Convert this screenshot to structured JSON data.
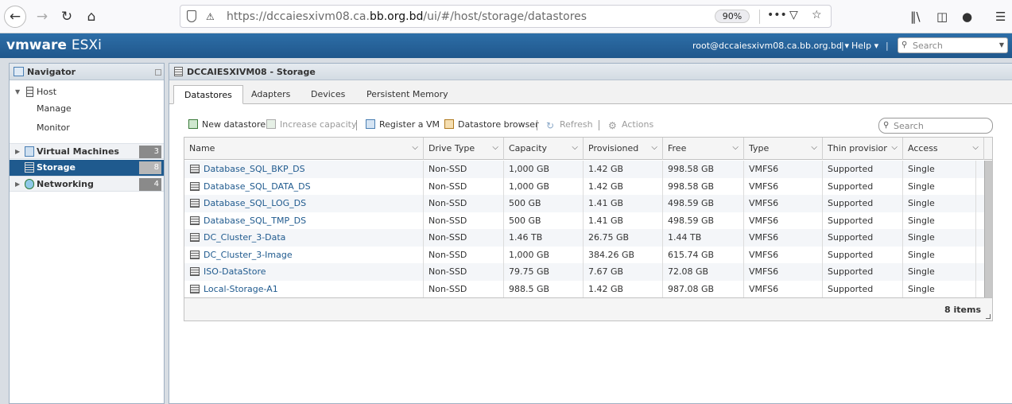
{
  "browser": {
    "url_prefix": "https://dccaiesxivm08.ca.",
    "url_domain": "bb.org.bd",
    "url_suffix": "/ui/#/host/storage/datastores",
    "zoom": "90%"
  },
  "header": {
    "logo_vm": "vmware",
    "logo_product": "ESXi",
    "user": "root@dccaiesxivm08.ca.bb.org.bd ▾",
    "help": "Help ▾",
    "search_placeholder": "Search"
  },
  "navigator": {
    "title": "Navigator",
    "host": "Host",
    "manage": "Manage",
    "monitor": "Monitor",
    "items": [
      {
        "label": "Virtual Machines",
        "count": "3"
      },
      {
        "label": "Storage",
        "count": "8"
      },
      {
        "label": "Networking",
        "count": "4"
      }
    ]
  },
  "content": {
    "title": "DCCAIESXIVM08 - Storage",
    "tabs": [
      "Datastores",
      "Adapters",
      "Devices",
      "Persistent Memory"
    ],
    "toolbar": {
      "new_datastore": "New datastore",
      "increase_capacity": "Increase capacity",
      "register_vm": "Register a VM",
      "datastore_browser": "Datastore browser",
      "refresh": "Refresh",
      "actions": "Actions"
    },
    "search_placeholder": "Search",
    "columns": [
      "Name",
      "Drive Type",
      "Capacity",
      "Provisioned",
      "Free",
      "Type",
      "Thin provision...",
      "Access"
    ],
    "rows": [
      [
        "Database_SQL_BKP_DS",
        "Non-SSD",
        "1,000 GB",
        "1.42 GB",
        "998.58 GB",
        "VMFS6",
        "Supported",
        "Single"
      ],
      [
        "Database_SQL_DATA_DS",
        "Non-SSD",
        "1,000 GB",
        "1.42 GB",
        "998.58 GB",
        "VMFS6",
        "Supported",
        "Single"
      ],
      [
        "Database_SQL_LOG_DS",
        "Non-SSD",
        "500 GB",
        "1.41 GB",
        "498.59 GB",
        "VMFS6",
        "Supported",
        "Single"
      ],
      [
        "Database_SQL_TMP_DS",
        "Non-SSD",
        "500 GB",
        "1.41 GB",
        "498.59 GB",
        "VMFS6",
        "Supported",
        "Single"
      ],
      [
        "DC_Cluster_3-Data",
        "Non-SSD",
        "1.46 TB",
        "26.75 GB",
        "1.44 TB",
        "VMFS6",
        "Supported",
        "Single"
      ],
      [
        "DC_Cluster_3-Image",
        "Non-SSD",
        "1,000 GB",
        "384.26 GB",
        "615.74 GB",
        "VMFS6",
        "Supported",
        "Single"
      ],
      [
        "ISO-DataStore",
        "Non-SSD",
        "79.75 GB",
        "7.67 GB",
        "72.08 GB",
        "VMFS6",
        "Supported",
        "Single"
      ],
      [
        "Local-Storage-A1",
        "Non-SSD",
        "988.5 GB",
        "1.42 GB",
        "987.08 GB",
        "VMFS6",
        "Supported",
        "Single"
      ]
    ],
    "item_count": "8 items"
  }
}
